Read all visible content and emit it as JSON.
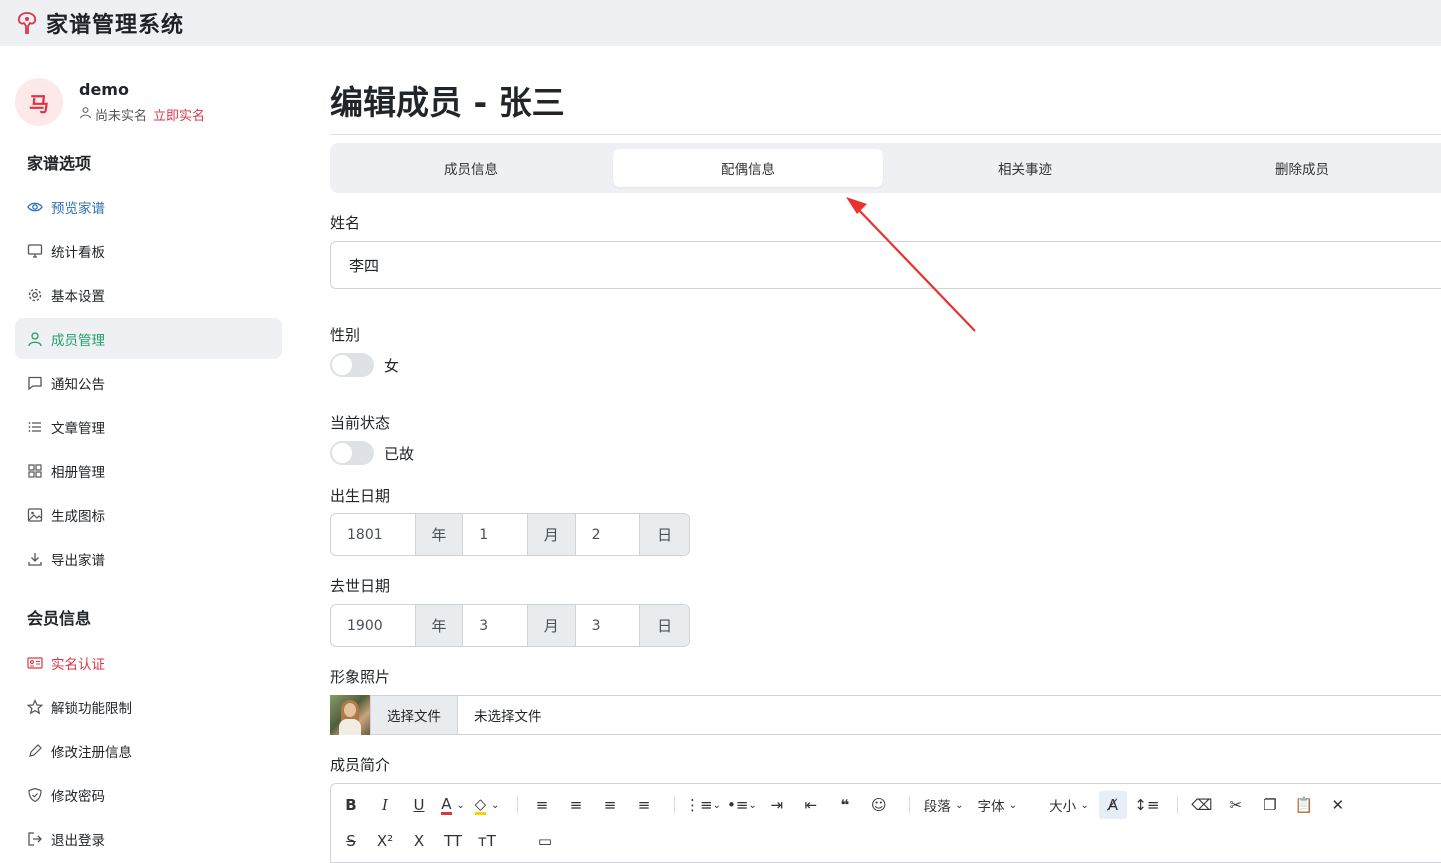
{
  "app": {
    "title": "家谱管理系统",
    "logo_icon": "tree-icon",
    "accent": "#dc3545"
  },
  "user": {
    "avatar_text": "马",
    "name": "demo",
    "status": "尚未实名",
    "verify_link": "立即实名"
  },
  "sidebar": {
    "section1_title": "家谱选项",
    "section1_items": [
      {
        "label": "预览家谱",
        "icon": "eye-icon"
      },
      {
        "label": "统计看板",
        "icon": "monitor-icon"
      },
      {
        "label": "基本设置",
        "icon": "gear-icon"
      },
      {
        "label": "成员管理",
        "icon": "person-icon"
      },
      {
        "label": "通知公告",
        "icon": "chat-icon"
      },
      {
        "label": "文章管理",
        "icon": "list-icon"
      },
      {
        "label": "相册管理",
        "icon": "grid-icon"
      },
      {
        "label": "生成图标",
        "icon": "image-icon"
      },
      {
        "label": "导出家谱",
        "icon": "download-icon"
      }
    ],
    "section2_title": "会员信息",
    "section2_items": [
      {
        "label": "实名认证",
        "icon": "id-card-icon"
      },
      {
        "label": "解锁功能限制",
        "icon": "star-icon"
      },
      {
        "label": "修改注册信息",
        "icon": "pen-icon"
      },
      {
        "label": "修改密码",
        "icon": "shield-icon"
      },
      {
        "label": "退出登录",
        "icon": "logout-icon"
      }
    ]
  },
  "main": {
    "page_title": "编辑成员 - 张三",
    "tabs": [
      "成员信息",
      "配偶信息",
      "相关事迹",
      "删除成员"
    ],
    "active_tab": "配偶信息",
    "name_label": "姓名",
    "name_value": "李四",
    "gender_label": "性别",
    "gender_switch_text": "女",
    "gender_switch_on": false,
    "status_label": "当前状态",
    "status_switch_text": "已故",
    "status_switch_on": false,
    "birth_label": "出生日期",
    "birth": {
      "year": "1801",
      "month": "1",
      "day": "2"
    },
    "death_label": "去世日期",
    "death": {
      "year": "1900",
      "month": "3",
      "day": "3"
    },
    "date_units": {
      "year": "年",
      "month": "月",
      "day": "日"
    },
    "photo_label": "形象照片",
    "file_button": "选择文件",
    "file_name": "未选择文件",
    "bio_label": "成员简介",
    "editor_toolbar": {
      "paragraph": "段落",
      "font": "字体",
      "size": "大小"
    }
  },
  "annotation": {
    "arrow_color": "#e8322b"
  }
}
